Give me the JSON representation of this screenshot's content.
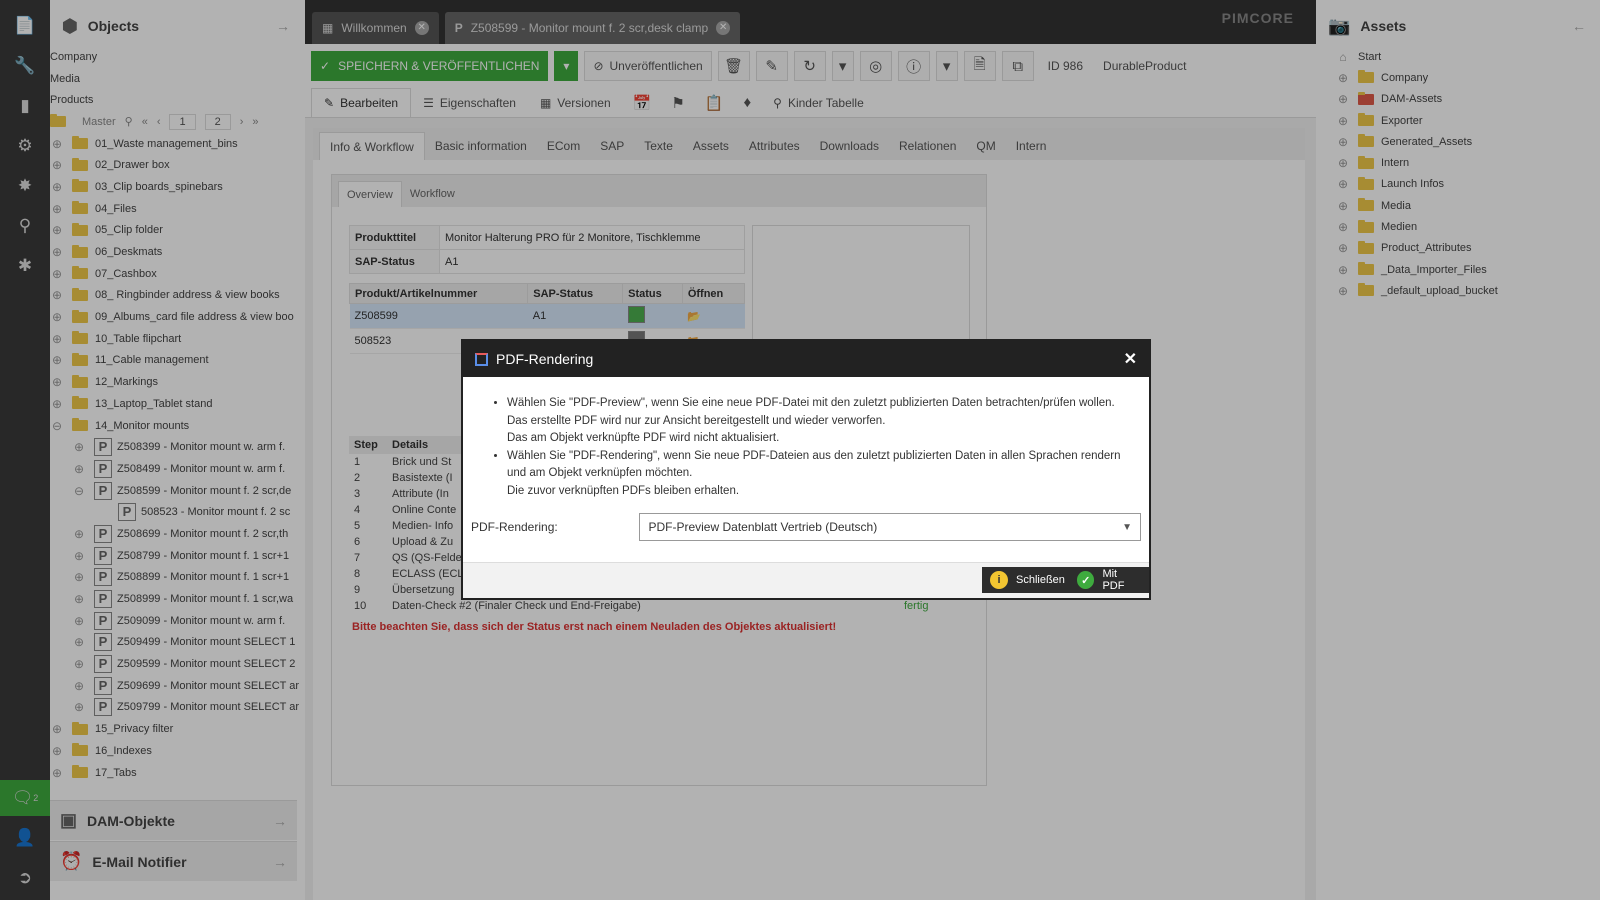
{
  "left_rail": {
    "chat_badge": "2"
  },
  "objects_panel": {
    "title": "Objects",
    "top_items": [
      "Company",
      "Media",
      "Products"
    ],
    "pager": {
      "label": "Master",
      "page1": "1",
      "page2": "2"
    },
    "folders": [
      "01_Waste management_bins",
      "02_Drawer box",
      "03_Clip boards_spinebars",
      "04_Files",
      "05_Clip folder",
      "06_Deskmats",
      "07_Cashbox",
      "08_ Ringbinder address & view books",
      "09_Albums_card file address & view boo",
      "10_Table flipchart",
      "11_Cable management",
      "12_Markings",
      "13_Laptop_Tablet stand",
      "14_Monitor mounts"
    ],
    "children": [
      "Z508399 - Monitor mount w. arm f.",
      "Z508499 - Monitor mount w. arm f.",
      "Z508599 - Monitor mount f. 2 scr,de"
    ],
    "grandchild": "508523 - Monitor mount f. 2 sc",
    "children2": [
      "Z508699 - Monitor mount f. 2 scr,th",
      "Z508799 - Monitor mount f. 1 scr+1",
      "Z508899 - Monitor mount f. 1 scr+1",
      "Z508999 - Monitor mount f. 1 scr,wa",
      "Z509099 - Monitor mount w. arm f.",
      "Z509499 - Monitor mount SELECT 1",
      "Z509599 - Monitor mount SELECT 2",
      "Z509699 - Monitor mount SELECT ar",
      "Z509799 - Monitor mount SELECT ar"
    ],
    "folders2": [
      "15_Privacy filter",
      "16_Indexes",
      "17_Tabs"
    ],
    "dam_panel": "DAM-Objekte",
    "email_panel": "E-Mail Notifier"
  },
  "tabs": {
    "welcome": "Willkommen",
    "object": "Z508599 - Monitor mount f. 2 scr,desk clamp",
    "brand": "PIMCORE"
  },
  "toolbar": {
    "save_label": "SPEICHERN & VERÖFFENTLICHEN",
    "unpublish_label": "Unveröffentlichen",
    "id_label": "ID 986",
    "class_label": "DurableProduct"
  },
  "edit_tabs": {
    "edit": "Bearbeiten",
    "props": "Eigenschaften",
    "versions": "Versionen",
    "children": "Kinder Tabelle"
  },
  "sub_tabs": [
    "Info & Workflow",
    "Basic information",
    "ECom",
    "SAP",
    "Texte",
    "Assets",
    "Attributes",
    "Downloads",
    "Relationen",
    "QM",
    "Intern"
  ],
  "inner_tabs": [
    "Overview",
    "Workflow"
  ],
  "overview": {
    "title_label": "Produkttitel",
    "title_value": "Monitor Halterung PRO für 2 Monitore, Tischklemme",
    "sap_label": "SAP-Status",
    "sap_value": "A1",
    "products_headers": [
      "Produkt/Artikelnummer",
      "SAP-Status",
      "Status",
      "Öffnen"
    ],
    "products": [
      {
        "nr": "Z508599",
        "sap": "A1"
      },
      {
        "nr": "508523",
        "sap": ""
      }
    ],
    "steps_headers": [
      "Step",
      "Details"
    ],
    "steps": [
      {
        "n": "1",
        "d": "Brick und St"
      },
      {
        "n": "2",
        "d": "Basistexte (I"
      },
      {
        "n": "3",
        "d": "Attribute (In"
      },
      {
        "n": "4",
        "d": "Online Conte"
      },
      {
        "n": "5",
        "d": "Medien- Info"
      },
      {
        "n": "6",
        "d": "Upload & Zu"
      },
      {
        "n": "7",
        "d": "QS (QS-Felde"
      },
      {
        "n": "8",
        "d": "ECLASS (ECL"
      },
      {
        "n": "9",
        "d": "Übersetzung"
      },
      {
        "n": "10",
        "d": "Daten-Check #2 (Finaler Check und End-Freigabe)",
        "s": "fertig"
      }
    ],
    "warning": "Bitte beachten Sie, dass sich der Status erst nach einem Neuladen des Objektes aktualisiert!"
  },
  "assets_panel": {
    "title": "Assets",
    "items": [
      "Start",
      "Company",
      "DAM-Assets",
      "Exporter",
      "Generated_Assets",
      "Intern",
      "Launch Infos",
      "Media",
      "Medien",
      "Product_Attributes",
      "_Data_Importer_Files",
      "_default_upload_bucket"
    ]
  },
  "dialog": {
    "title": "PDF-Rendering",
    "bullet1": [
      "Wählen Sie \"PDF-Preview\", wenn Sie eine neue PDF-Datei mit den zuletzt publizierten Daten betrachten/prüfen wollen.",
      "Das erstellte PDF wird nur zur Ansicht bereitgestellt und wieder verworfen.",
      "Das am Objekt verknüpfte PDF wird nicht aktualisiert."
    ],
    "bullet2": [
      "Wählen Sie \"PDF-Rendering\", wenn Sie neue PDF-Dateien aus den zuletzt publizierten Daten in allen Sprachen rendern",
      "und am Objekt verknüpfen möchten.",
      "Die zuvor verknüpften PDFs bleiben erhalten."
    ],
    "field_label": "PDF-Rendering:",
    "select_value": "PDF-Preview Datenblatt Vertrieb (Deutsch)",
    "close_label": "Schließen",
    "confirm_label": "Mit PDF"
  }
}
